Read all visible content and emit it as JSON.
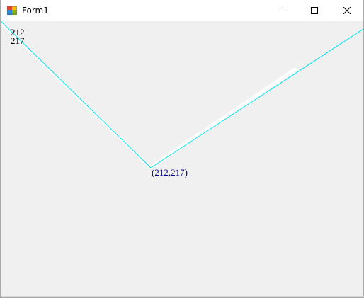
{
  "window": {
    "title": "Form1",
    "icon": "form-app-icon",
    "controls": {
      "minimize_icon": "minimize-icon",
      "maximize_icon": "maximize-icon",
      "close_icon": "close-icon"
    }
  },
  "canvas": {
    "mouse_x": "212",
    "mouse_y": "217",
    "point_label": "(212,217)",
    "line_color": "#00e5ee",
    "background_color": "#f0f0f0",
    "label_color": "#00008b"
  }
}
